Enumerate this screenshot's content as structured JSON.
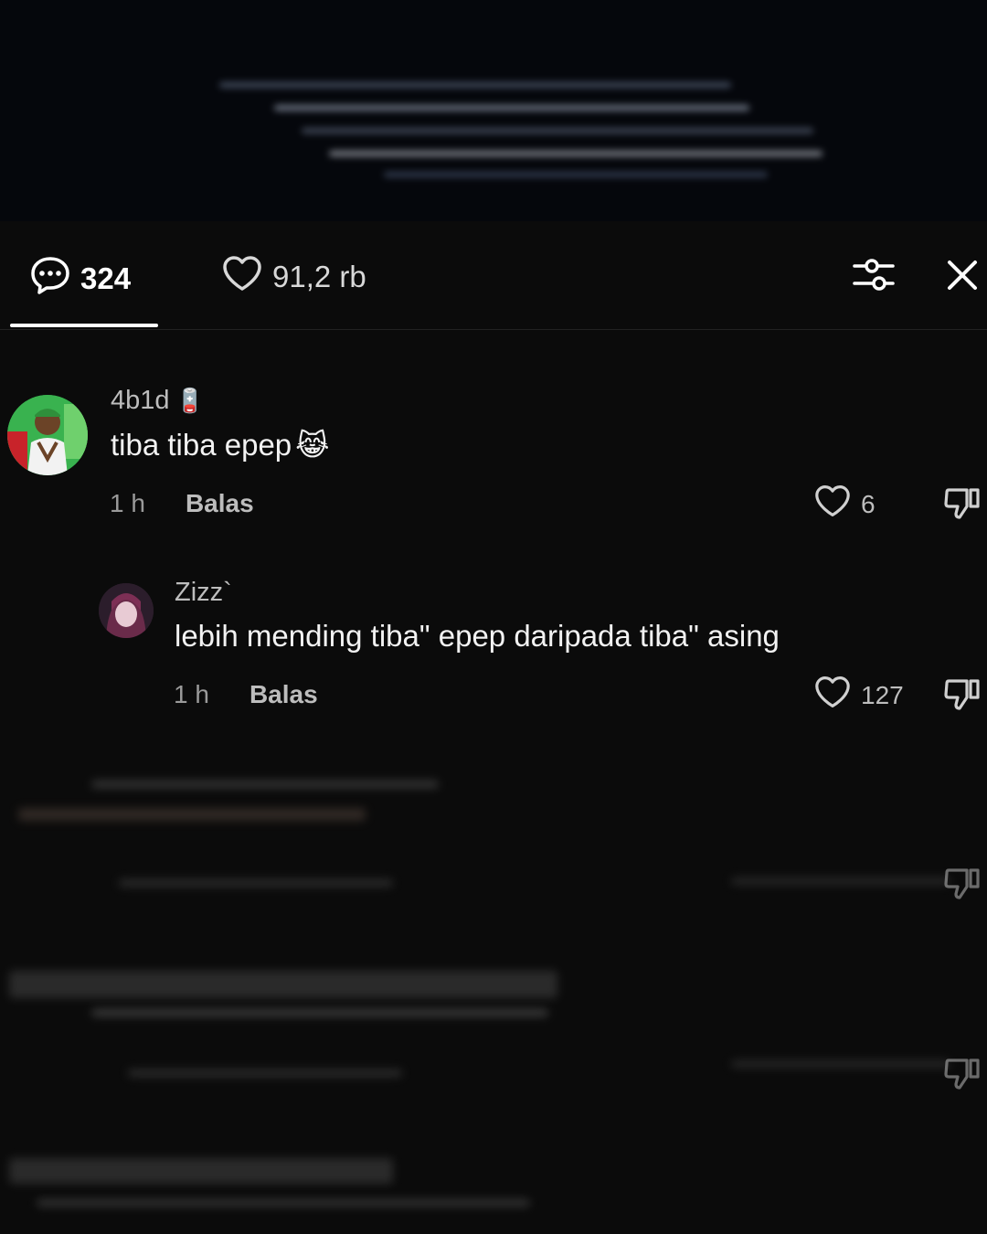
{
  "header": {
    "comment_count": "324",
    "like_count": "91,2 rb"
  },
  "icons": {
    "comments_tab": "chat-bubble-icon",
    "likes_tab": "heart-outline-icon",
    "filter": "sliders-icon",
    "close": "close-icon",
    "like": "heart-outline-icon",
    "dislike": "thumbs-down-icon"
  },
  "comments": [
    {
      "username": "4b1d",
      "badge": "🪫",
      "text": "tiba tiba epep",
      "emoji": "😹",
      "time": "1 h",
      "reply_label": "Balas",
      "likes": "6"
    },
    {
      "username": "Zizz`",
      "text": "lebih mending tiba\" epep daripada tiba\" asing",
      "time": "1 h",
      "reply_label": "Balas",
      "likes": "127"
    }
  ],
  "colors": {
    "background": "#0b0b0b",
    "text": "#ffffff",
    "muted": "#9a9a9a"
  }
}
